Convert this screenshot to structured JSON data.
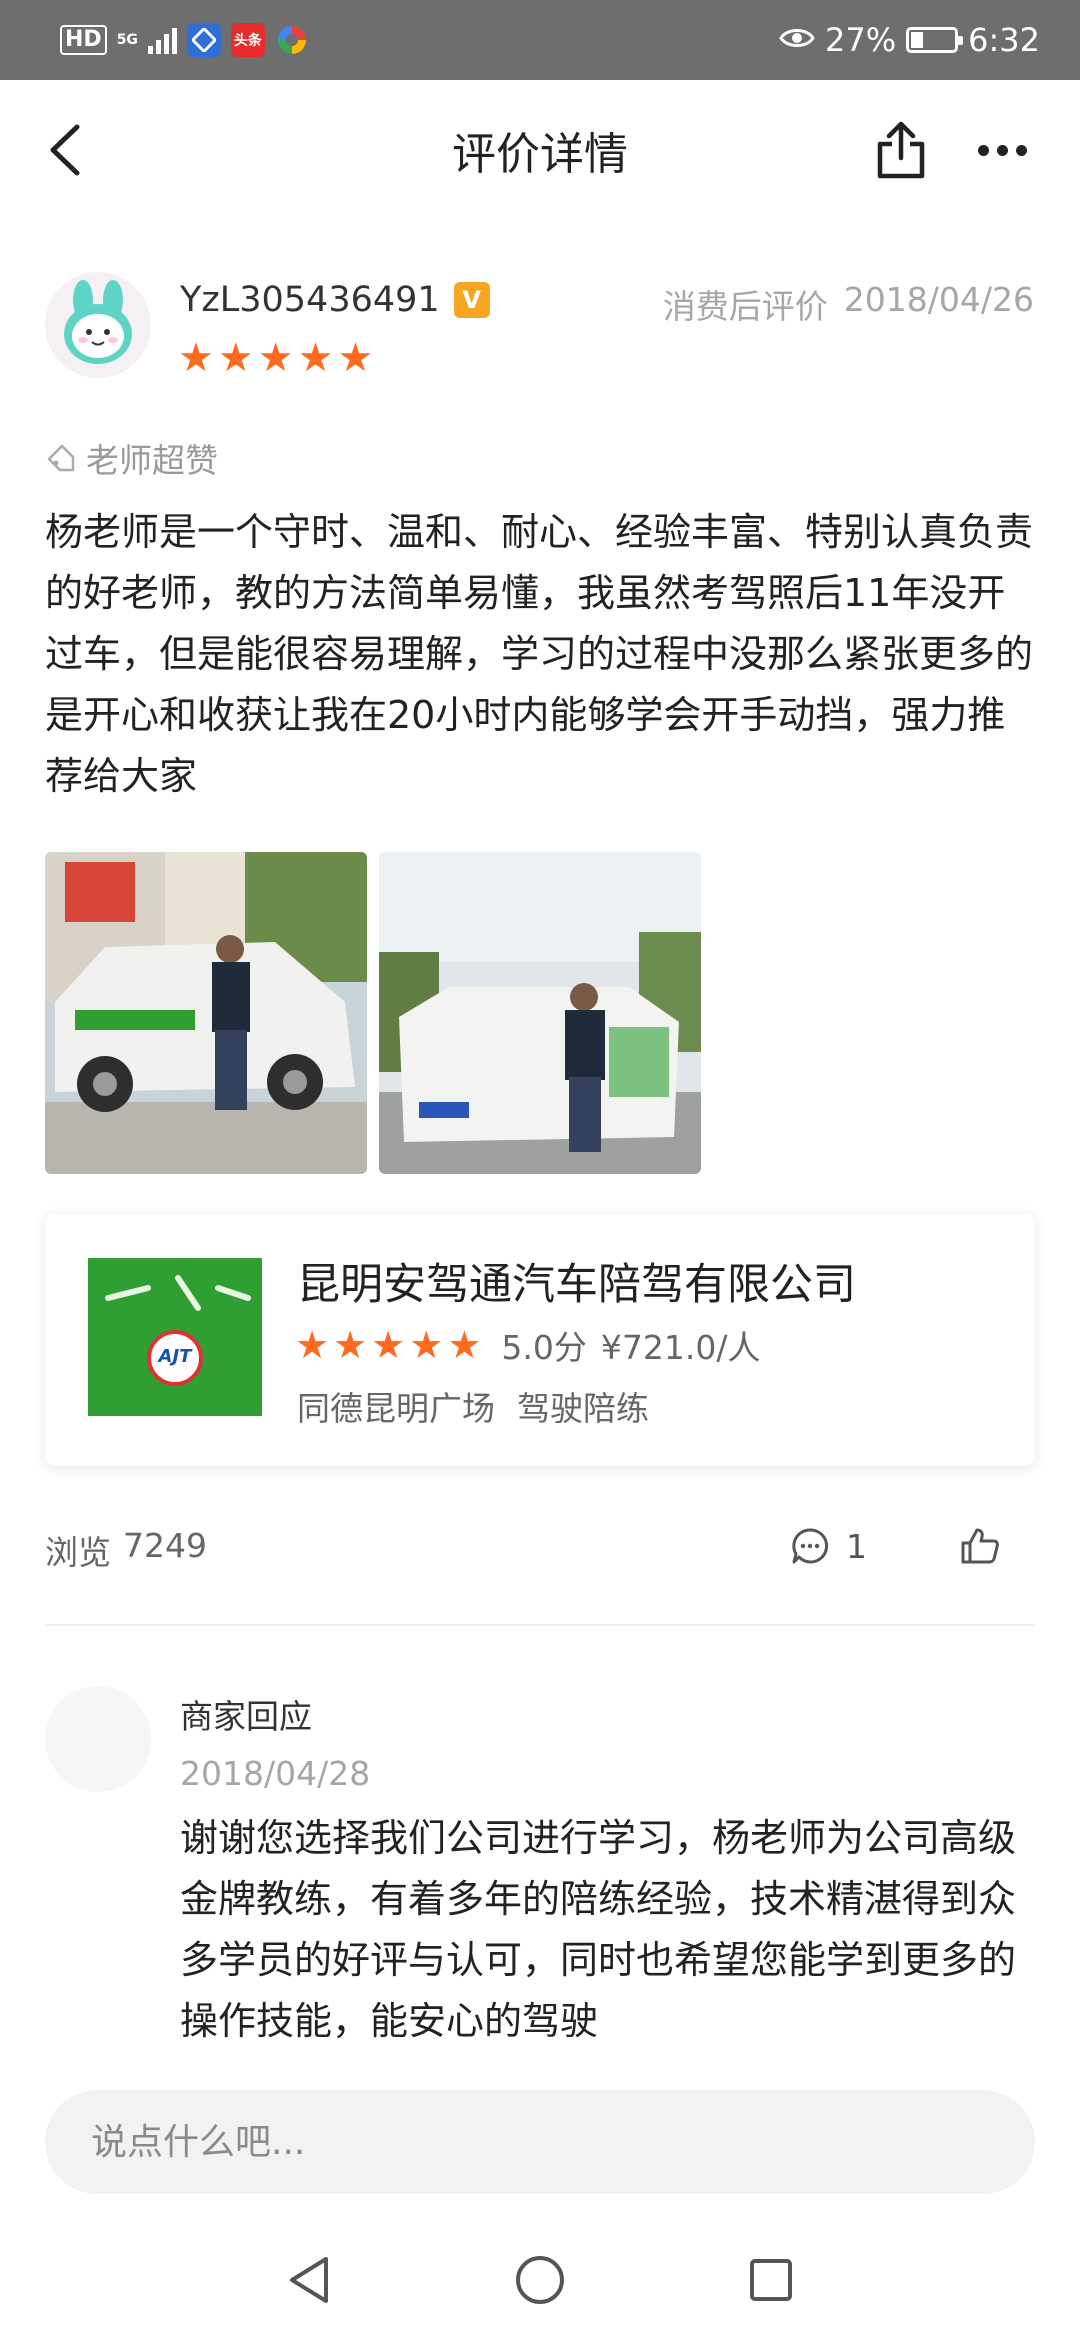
{
  "status_bar": {
    "hd": "HD",
    "network": "5G",
    "app_icon_2": "头条",
    "battery_percent": "27%",
    "battery_level": 0.27,
    "time": "6:32"
  },
  "header": {
    "title": "评价详情",
    "back_icon": "chevron-left-icon",
    "share_icon": "share-icon",
    "more_icon": "more-dots-icon"
  },
  "review": {
    "username": "YzL305436491",
    "vip_badge": "V",
    "review_type": "消费后评价",
    "date": "2018/04/26",
    "rating": 5,
    "tag": "老师超赞",
    "text": "杨老师是一个守时、温和、耐心、经验丰富、特别认真负责的好老师，教的方法简单易懂，我虽然考驾照后11年没开过车，但是能很容易理解，学习的过程中没那么紧张更多的是开心和收获让我在20小时内能够学会开手动挡，强力推荐给大家",
    "photo_count": 2
  },
  "merchant": {
    "name": "昆明安驾通汽车陪驾有限公司",
    "logo_text": "AJT",
    "rating": 5,
    "score": "5.0分",
    "price": "¥721.0/人",
    "location": "同德昆明广场",
    "category": "驾驶陪练"
  },
  "stats": {
    "views_label": "浏览",
    "views": "7249",
    "comments": "1",
    "comment_icon": "comment-bubble-icon",
    "like_icon": "thumbs-up-icon"
  },
  "reply": {
    "author": "商家回应",
    "date": "2018/04/28",
    "text": "谢谢您选择我们公司进行学习，杨老师为公司高级金牌教练，有着多年的陪练经验，技术精湛得到众多学员的好评与认可，同时也希望您能学到更多的操作技能，能安心的驾驶"
  },
  "comment_box": {
    "placeholder": "说点什么吧..."
  },
  "colors": {
    "star": "#ff6a1f",
    "vip": "#f6a623",
    "status_bar": "#6e6e6e",
    "muted_text": "#a6a6a6"
  }
}
